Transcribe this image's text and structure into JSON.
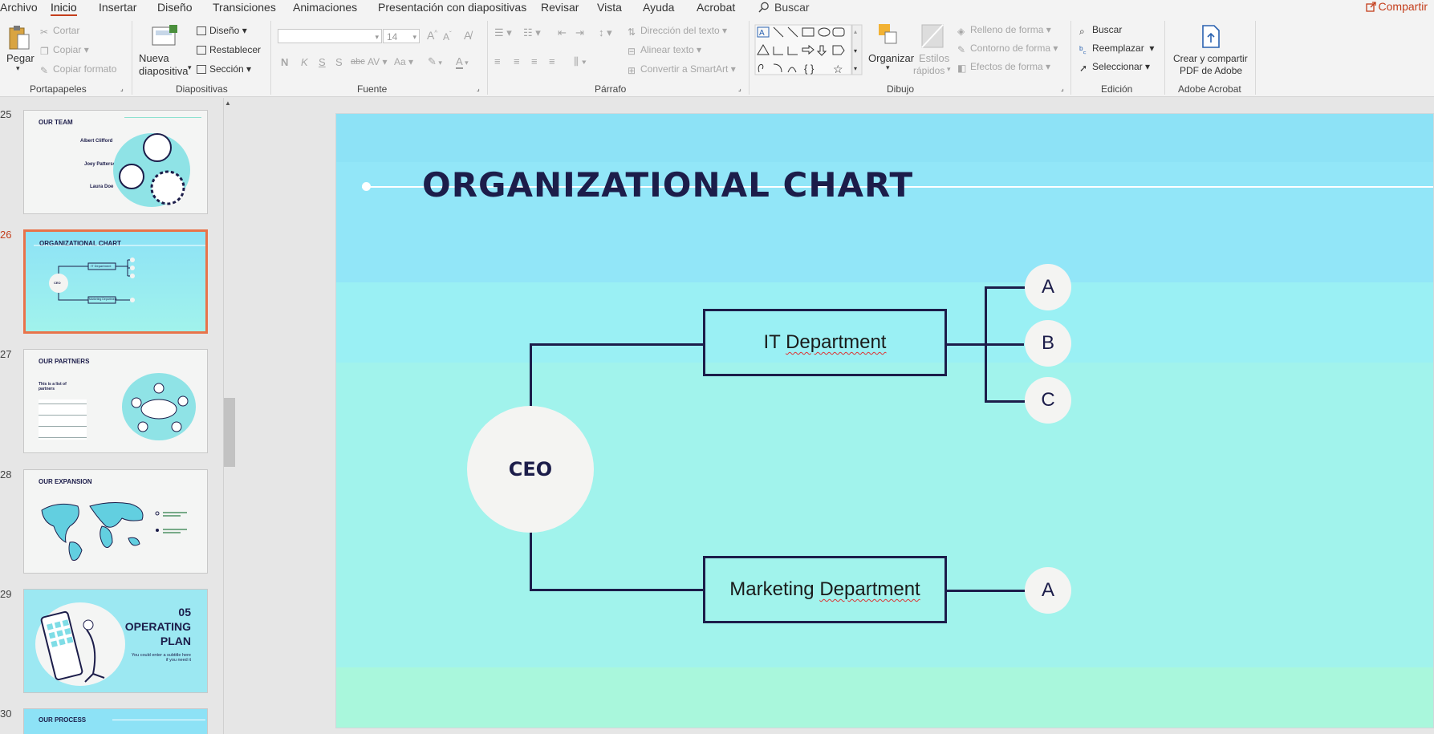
{
  "menu": {
    "tabs": [
      "Archivo",
      "Inicio",
      "Insertar",
      "Diseño",
      "Transiciones",
      "Animaciones",
      "Presentación con diapositivas",
      "Revisar",
      "Vista",
      "Ayuda",
      "Acrobat"
    ],
    "search": "Buscar",
    "share": "Compartir"
  },
  "ribbon": {
    "clipboard": {
      "label": "Portapapeles",
      "paste": "Pegar",
      "cut": "Cortar",
      "copy": "Copiar",
      "format": "Copiar formato"
    },
    "slides": {
      "label": "Diapositivas",
      "new_slide_1": "Nueva",
      "new_slide_2": "diapositiva",
      "layout": "Diseño",
      "reset": "Restablecer",
      "section": "Sección"
    },
    "font": {
      "label": "Fuente",
      "size": "14",
      "bold": "N",
      "italic": "K",
      "underline": "S",
      "shadow": "S",
      "strike": "abc",
      "spacing": "AV",
      "case": "Aa",
      "color_letter": "A",
      "grow": "A",
      "shrink": "A"
    },
    "paragraph": {
      "label": "Párrafo",
      "text_dir": "Dirección del texto",
      "align_text": "Alinear texto",
      "smartart": "Convertir a SmartArt"
    },
    "drawing": {
      "label": "Dibujo",
      "arrange": "Organizar",
      "quick_styles_1": "Estilos",
      "quick_styles_2": "rápidos",
      "fill": "Relleno de forma",
      "outline": "Contorno de forma",
      "effects": "Efectos de forma"
    },
    "editing": {
      "label": "Edición",
      "find": "Buscar",
      "replace": "Reemplazar",
      "select": "Seleccionar"
    },
    "acrobat": {
      "label": "Adobe Acrobat",
      "create_1": "Crear y compartir",
      "create_2": "PDF de Adobe"
    }
  },
  "thumbnails": [
    {
      "num": "25",
      "title": "OUR TEAM",
      "names": [
        "Albert Clifford",
        "Joey Patterson",
        "Laura Doe"
      ]
    },
    {
      "num": "26",
      "title": "ORGANIZATIONAL CHART",
      "selected": true,
      "ceo": "CEO",
      "it": "IT Department",
      "mkt": "Marketing Department"
    },
    {
      "num": "27",
      "title": "OUR PARTNERS",
      "sub": "This is a list of partners"
    },
    {
      "num": "28",
      "title": "OUR EXPANSION"
    },
    {
      "num": "29",
      "big_1": "05",
      "big_2": "OPERATING",
      "big_3": "PLAN",
      "sub": "You could enter a subtitle here if you need it"
    },
    {
      "num": "30",
      "title": "OUR PROCESS"
    }
  ],
  "slide": {
    "title": "ORGANIZATIONAL CHART",
    "ceo": "CEO",
    "departments": [
      {
        "name": "IT Department",
        "subs": [
          "A",
          "B",
          "C"
        ]
      },
      {
        "name": "Marketing Department",
        "subs": [
          "A"
        ]
      }
    ]
  },
  "colors": {
    "accent": "#c43e1c",
    "navy": "#1c1d4a",
    "slide_top": "#8de2f6",
    "slide_bottom": "#a9f7dc"
  }
}
